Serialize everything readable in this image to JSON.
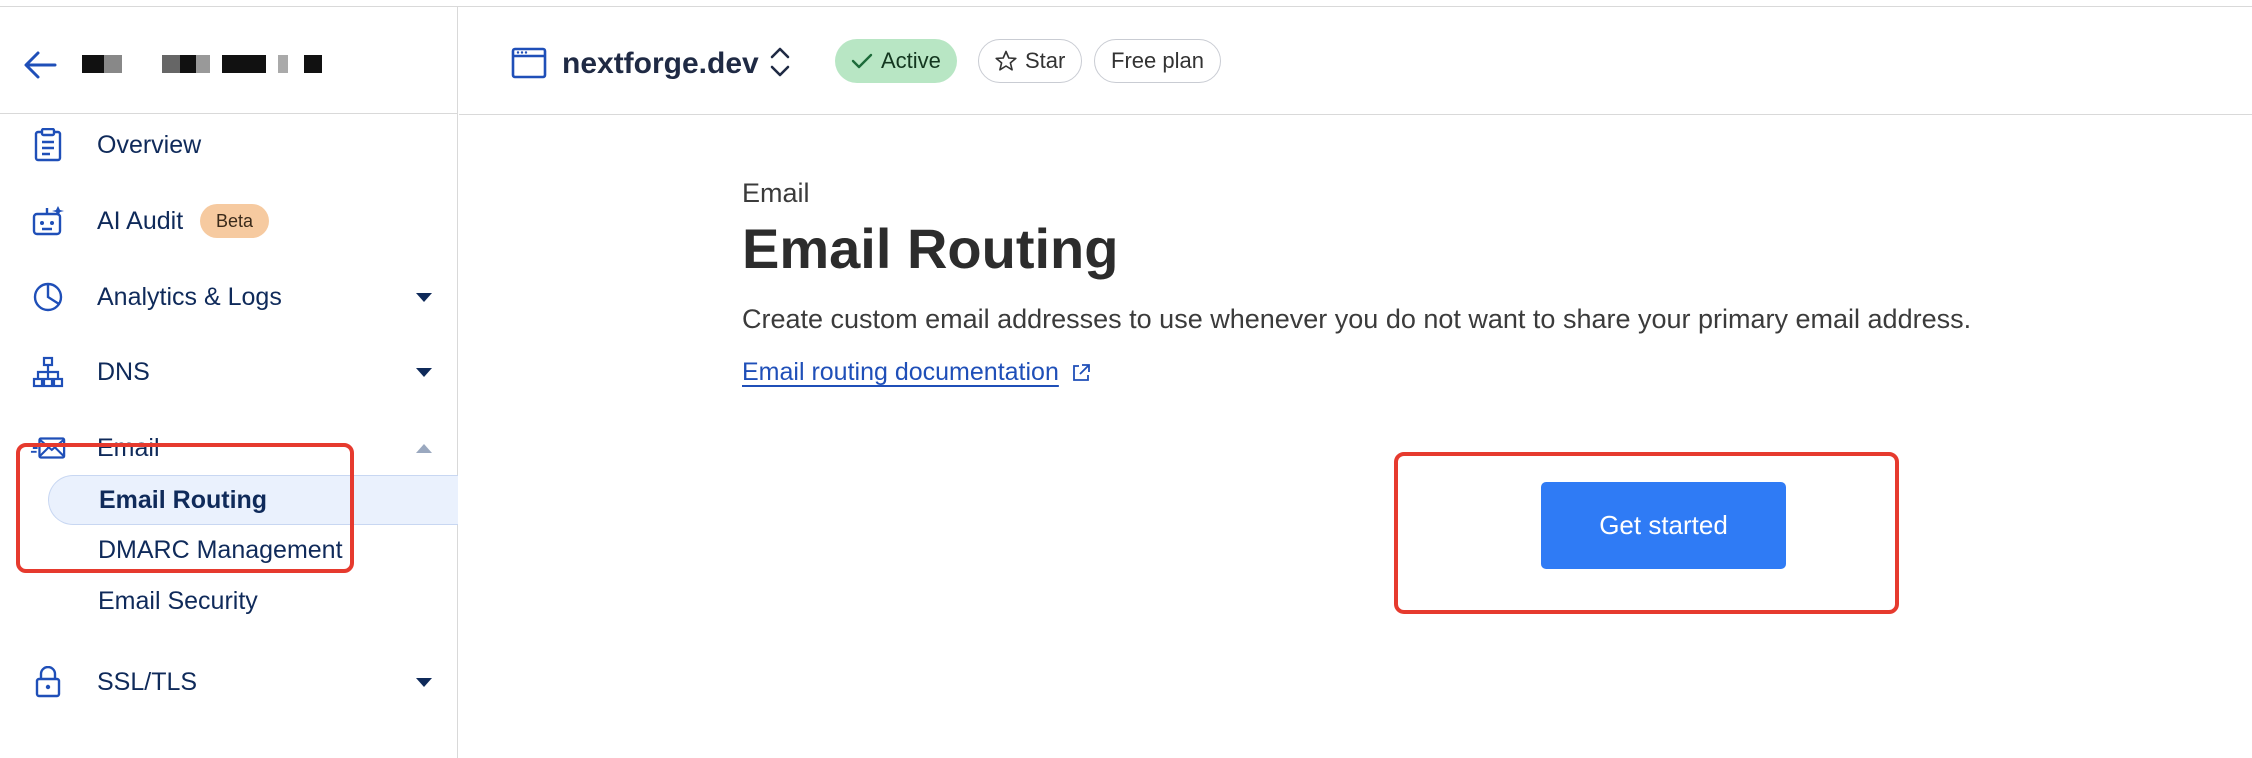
{
  "sidebar": {
    "back_icon": "arrow-left-icon",
    "account_name_redacted": true,
    "items": [
      {
        "label": "Overview",
        "icon": "clipboard-icon"
      },
      {
        "label": "AI Audit",
        "icon": "robot-icon",
        "badge": "Beta"
      },
      {
        "label": "Analytics & Logs",
        "icon": "pie-chart-icon",
        "expanded": false
      },
      {
        "label": "DNS",
        "icon": "network-icon",
        "expanded": false
      },
      {
        "label": "Email",
        "icon": "envelope-icon",
        "expanded": true
      },
      {
        "label": "SSL/TLS",
        "icon": "lock-icon",
        "expanded": false
      }
    ],
    "email_subitems": [
      {
        "label": "Email Routing",
        "active": true
      },
      {
        "label": "DMARC Management",
        "active": false
      },
      {
        "label": "Email Security",
        "active": false
      }
    ]
  },
  "header": {
    "domain": "nextforge.dev",
    "status": "Active",
    "star_label": "Star",
    "plan": "Free plan"
  },
  "main": {
    "eyebrow": "Email",
    "title": "Email Routing",
    "description": "Create custom email addresses to use whenever you do not want to share your primary email address.",
    "doc_link": "Email routing documentation",
    "cta_label": "Get started"
  },
  "colors": {
    "accent": "#2f7bf5",
    "active_badge": "#b8e6c4",
    "beta_badge": "#f6caa0",
    "nav_text": "#0f2a5a",
    "highlight": "#e63a2e",
    "link": "#1f4fb8"
  }
}
